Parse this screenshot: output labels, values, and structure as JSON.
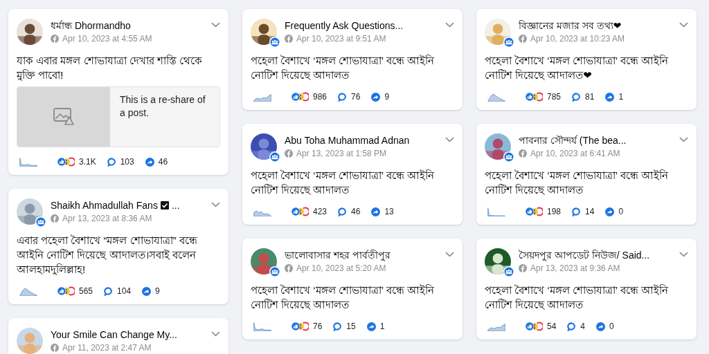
{
  "columns": [
    {
      "posts": [
        {
          "name": "ধর্মান্ধ Dhormandho",
          "verified": false,
          "group_badge": false,
          "date": "Apr 10, 2023 at 4:55 AM",
          "text": "যাক এবার মঙ্গল শোভাযাত্রা দেখার শাস্তি থেকে মুক্তি পাবো!",
          "shared": {
            "text": "This is a re-share of a post."
          },
          "reactions": "3.1K",
          "comments": "103",
          "shares": "46"
        },
        {
          "name": "Shaikh Ahmadullah Fans",
          "verified": true,
          "name_tail": "...",
          "group_badge": true,
          "date": "Apr 13, 2023 at 8:36 AM",
          "text": "এবার পহেলা বৈশাখে “মঙ্গল শোভাযাত্রা” বন্ধে আইনি নোটিশ দিয়েছে আদালত।সবাই বলেন আলহামদুলিল্লাহ!",
          "reactions": "565",
          "comments": "104",
          "shares": "9"
        },
        {
          "name": "Your Smile Can Change My...",
          "verified": false,
          "group_badge": false,
          "date": "Apr 11, 2023 at 2:47 AM"
        }
      ]
    },
    {
      "posts": [
        {
          "name": "Frequently Ask Questions...",
          "verified": false,
          "group_badge": true,
          "date": "Apr 10, 2023 at 9:51 AM",
          "text": "পহেলা বৈশাখে ‘মঙ্গল শোভাযাত্রা’ বন্ধে আইনি নোটিশ দিয়েছে আদালত",
          "reactions": "986",
          "comments": "76",
          "shares": "9"
        },
        {
          "name": "Abu Toha Muhammad Adnan",
          "verified": false,
          "group_badge": true,
          "date": "Apr 13, 2023 at 1:58 PM",
          "text": "পহেলা বৈশাখে ‘মঙ্গল শোভাযাত্রা’ বন্ধে আইনি নোটিশ দিয়েছে আদালত",
          "reactions": "423",
          "comments": "46",
          "shares": "13"
        },
        {
          "name": "ভালোবাসার শহর পার্বতীপুর",
          "verified": false,
          "group_badge": true,
          "date": "Apr 10, 2023 at 5:20 AM",
          "text": "পহেলা বৈশাখে ‘মঙ্গল শোভাযাত্রা’ বন্ধে আইনি নোটিশ দিয়েছে আদালত",
          "reactions": "76",
          "comments": "15",
          "shares": "1"
        }
      ]
    },
    {
      "posts": [
        {
          "name": "বিজ্ঞানের মজার সব তথ্য❤",
          "verified": false,
          "group_badge": true,
          "date": "Apr 10, 2023 at 10:23 AM",
          "text": "পহেলা বৈশাখে ‘মঙ্গল শোভাযাত্রা’ বন্ধে আইনি নোটিশ দিয়েছে আদালত❤",
          "reactions": "785",
          "comments": "81",
          "shares": "1"
        },
        {
          "name": "পাবনার সৌন্দর্য (The bea...",
          "verified": false,
          "group_badge": true,
          "date": "Apr 10, 2023 at 6:41 AM",
          "text": "পহেলা বৈশাখে ‘মঙ্গল শোভাযাত্রা’ বন্ধে আইনি নোটিশ দিয়েছে আদালত",
          "reactions": "198",
          "comments": "14",
          "shares": "0"
        },
        {
          "name": "সৈয়দপুর আপডেট নিউজ/ Said...",
          "verified": false,
          "group_badge": true,
          "date": "Apr 13, 2023 at 9:36 AM",
          "text": "পহেলা বৈশাখে ‘মঙ্গল শোভাযাত্রা’ বন্ধে আইনি নোটিশ দিয়েছে আদালত",
          "reactions": "54",
          "comments": "4",
          "shares": "0"
        }
      ]
    }
  ]
}
